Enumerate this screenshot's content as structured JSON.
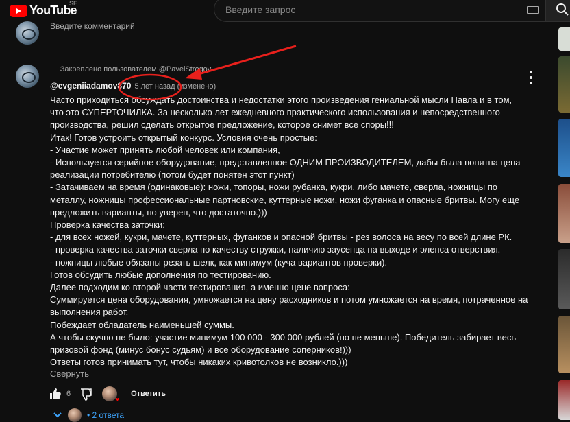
{
  "header": {
    "logo_text": "YouTube",
    "region": "SE",
    "search_placeholder": "Введите запрос"
  },
  "add_comment": {
    "placeholder": "Введите комментарий"
  },
  "comment": {
    "pinned_text": "Закреплено пользователем @PavelStrogov",
    "author": "@evgeniiadamov870",
    "time": "5 лет назад (изменено)",
    "lines": [
      "Часто приходиться обсуждать достоинства и недостатки этого произведения гениальной мысли Павла и в том,",
      "что это СУПЕРТОЧИЛКА. За несколько лет ежедневного практического использования и непосредственного",
      "производства, решил сделать открытое предложение, которое снимет все споры!!!",
      "Итак! Готов устроить открытый конкурс. Условия очень простые:",
      "- Участие может принять любой человек или компания,",
      "- Используется серийное оборудование, представленное ОДНИМ ПРОИЗВОДИТЕЛЕМ, дабы была понятна цена",
      "реализации потребителю (потом будет понятен этот пункт)",
      "- Затачиваем на время (одинаковые): ножи, топоры, ножи рубанка, кукри, либо мачете, сверла, ножницы по",
      "металлу, ножницы профессиональные партновские, куттерные ножи, ножи фуганка и опасные бритвы. Могу еще",
      "предложить варианты, но уверен, что достаточно.)))",
      "Проверка качества заточки:",
      "- для всех ножей, кукри, мачете, куттерных, фуганков и опасной бритвы - рез волоса на весу по всей длине РК.",
      "- проверка качества заточки сверла по качеству стружки, наличию заусенца на выходе и элепса отверствия.",
      "- ножницы любые обязаны резать шелк, как минимум (куча вариантов проверки).",
      "Готов обсудить любые дополнения по тестированию.",
      "Далее подходим ко второй части тестирования, а именно цене вопроса:",
      "Суммируется цена оборудования, умножается на цену расходников и потом умножается на время, потраченное на",
      "выполнения работ.",
      "Побеждает обладатель наименьшей суммы.",
      "А чтобы скучно не было: участие минимум 100 000 - 300 000 рублей (но не меньше). Победитель забирает весь",
      "призовой фонд (минус бонус судьям) и все оборудование соперников!)))",
      "Ответы готов принимать тут, чтобы никаких кривотолков не возникло.)))"
    ],
    "collapse_label": "Свернуть",
    "like_count": "6",
    "reply_label": "Ответить",
    "replies_label": "2 ответа"
  },
  "annotation": {
    "color": "#e8201c"
  }
}
